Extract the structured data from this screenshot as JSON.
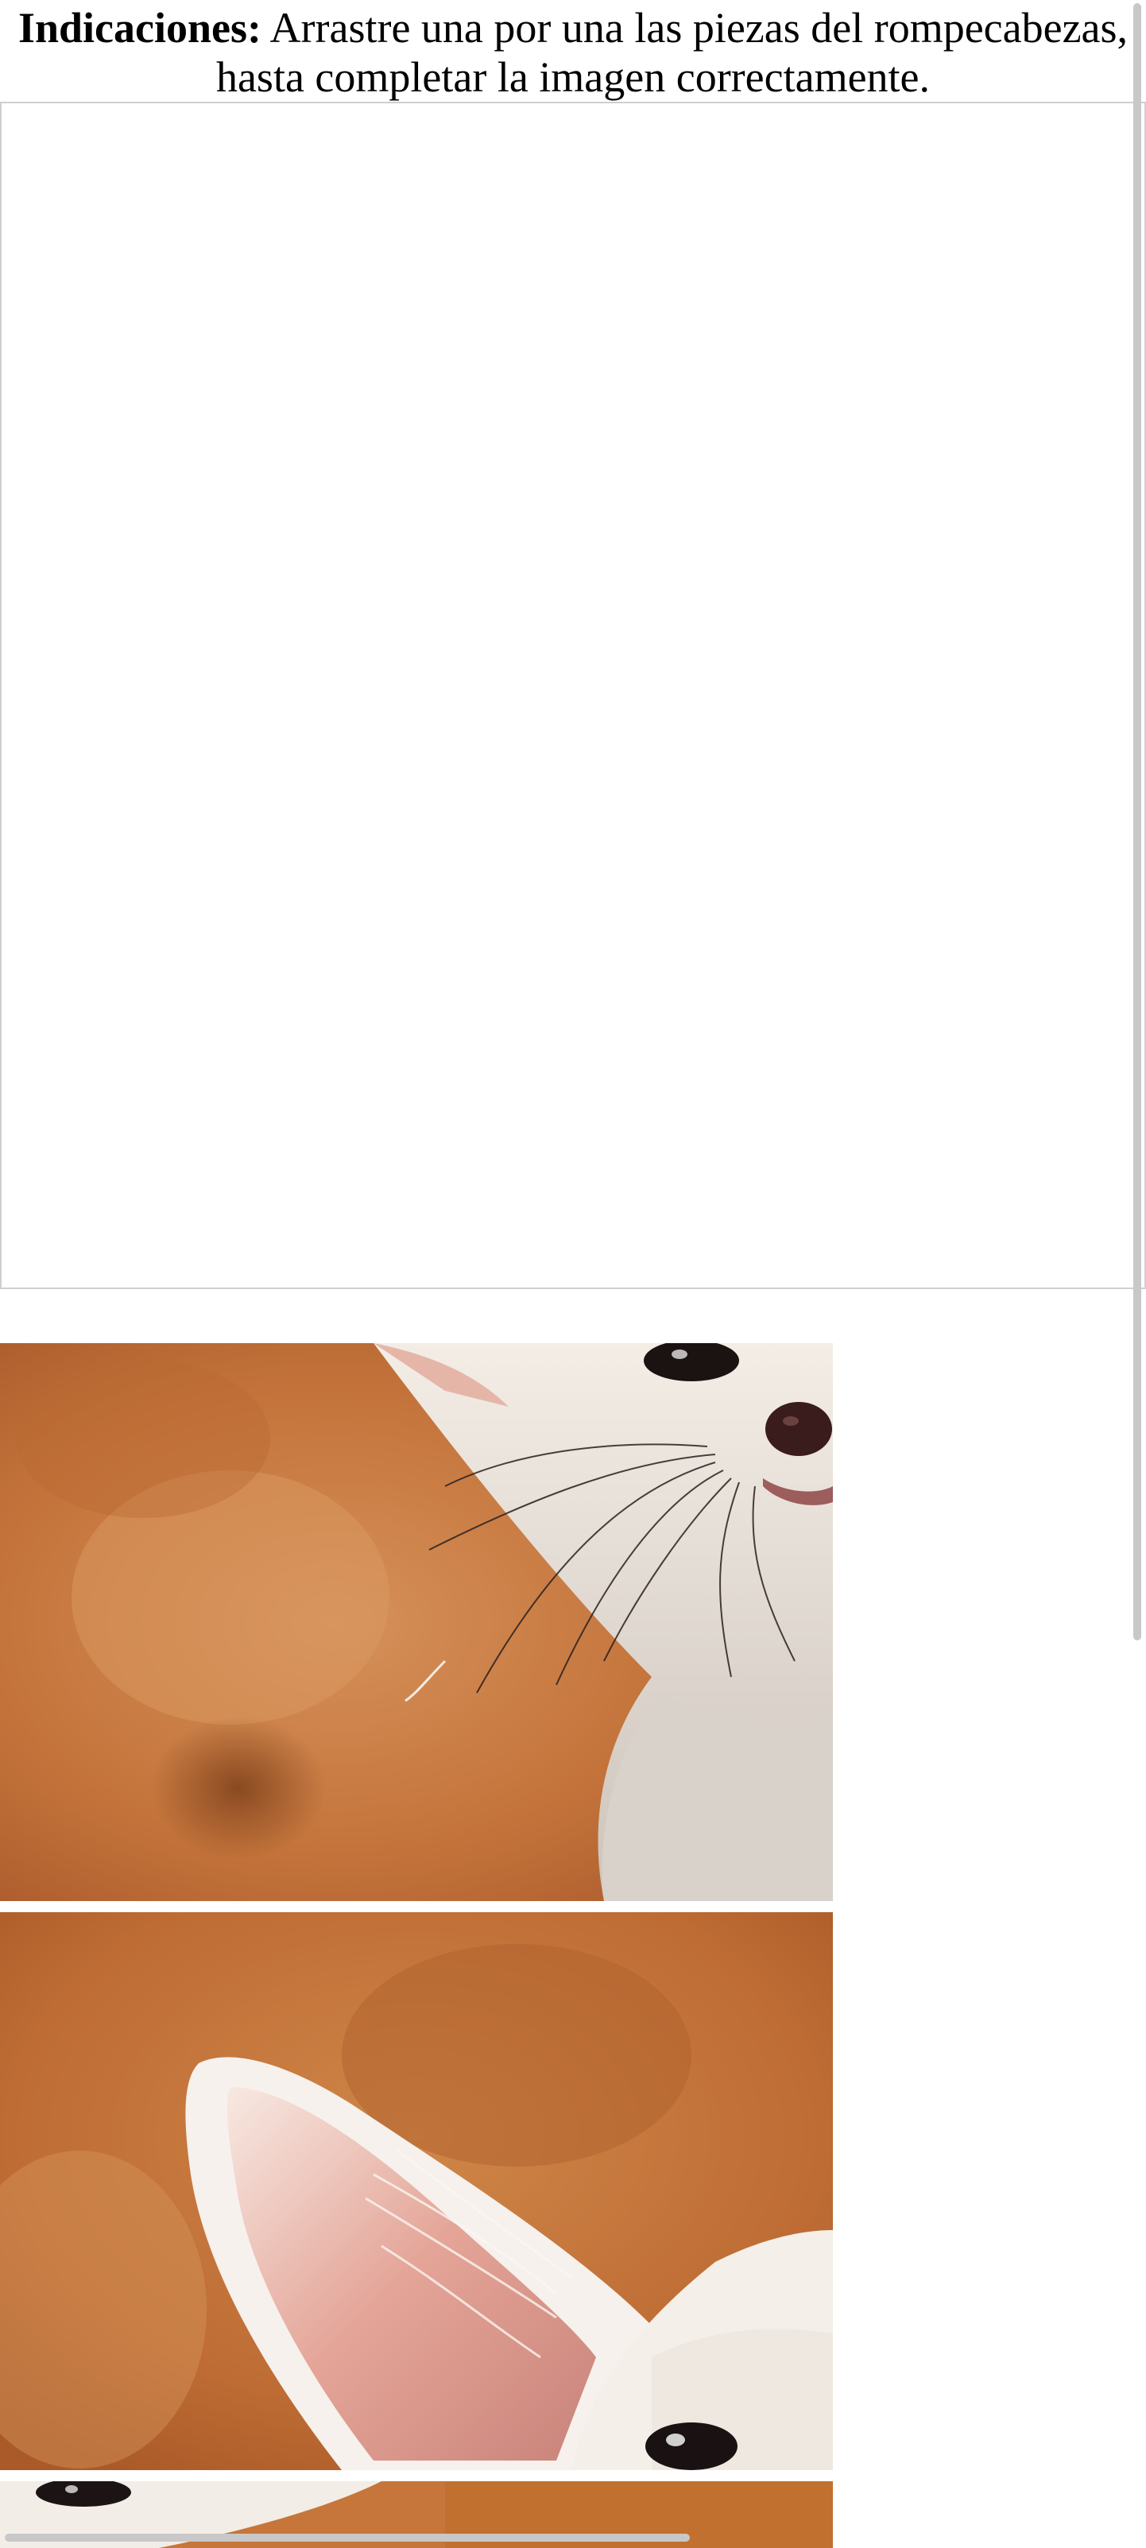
{
  "instructions": {
    "label": "Indicaciones:",
    "text": "Arrastre una por una las piezas del rompecabezas, hasta completar la imagen correctamente."
  },
  "board": {
    "description": "empty puzzle drop area"
  },
  "pieces": [
    {
      "name": "fox-snout-whiskers"
    },
    {
      "name": "fox-ear-eye"
    },
    {
      "name": "fox-eye-partial"
    }
  ],
  "colors": {
    "background_orange": "#c7773a",
    "fur_white": "#f4efe8",
    "ear_pink": "#e8a89a",
    "board_border": "#cfcfcf",
    "scrollbar": "#c8c8c8"
  }
}
